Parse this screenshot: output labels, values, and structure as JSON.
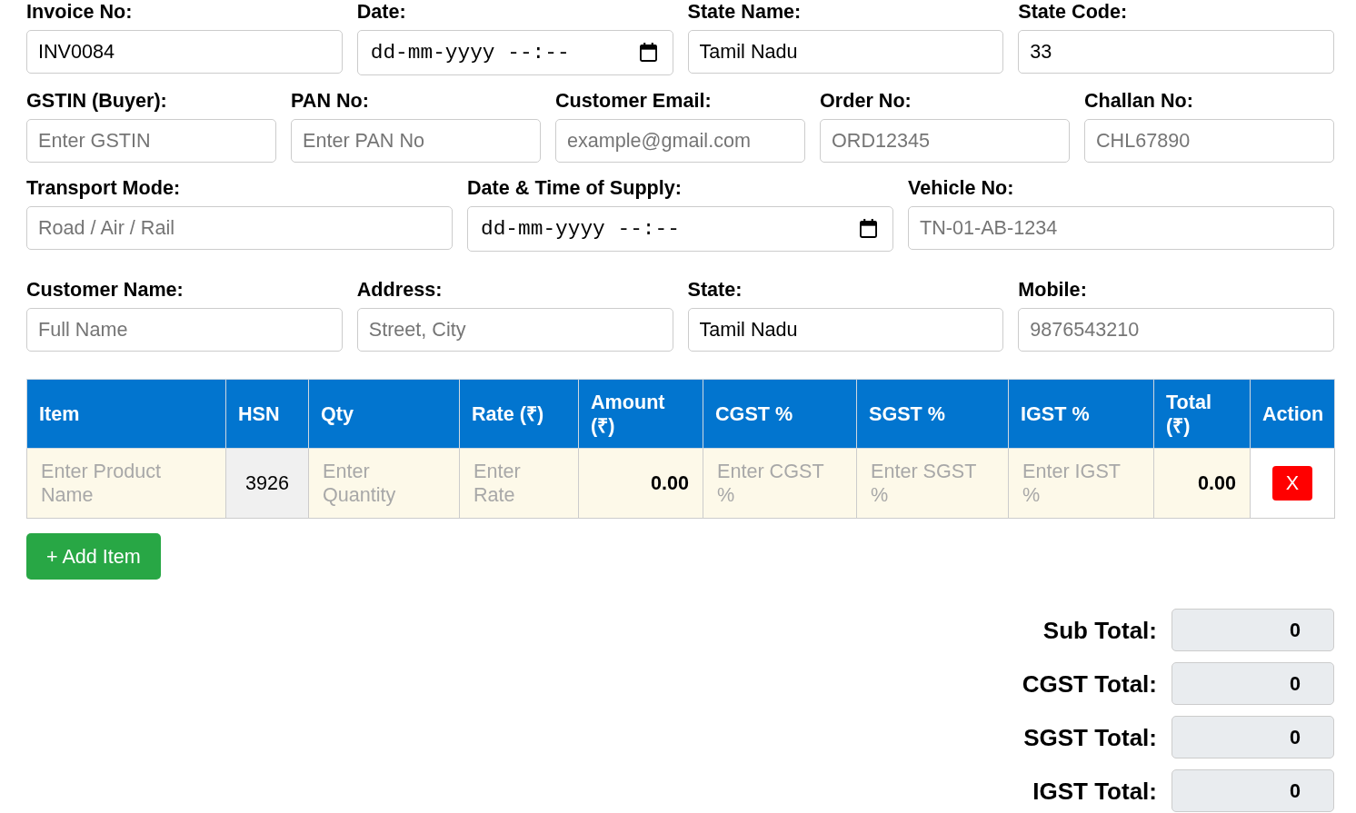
{
  "invoice_rows": [
    {
      "fields": [
        {
          "label": "Invoice No:",
          "kind": "text",
          "value": "INV0084"
        },
        {
          "label": "Date:",
          "kind": "datetime",
          "placeholder": "dd-mm-yyyy --:--"
        },
        {
          "label": "State Name:",
          "kind": "text",
          "value": "Tamil Nadu"
        },
        {
          "label": "State Code:",
          "kind": "text",
          "value": "33"
        }
      ]
    },
    {
      "fields": [
        {
          "label": "GSTIN (Buyer):",
          "kind": "text",
          "placeholder": "Enter GSTIN"
        },
        {
          "label": "PAN No:",
          "kind": "text",
          "placeholder": "Enter PAN No"
        },
        {
          "label": "Customer Email:",
          "kind": "text",
          "placeholder": "example@gmail.com"
        },
        {
          "label": "Order No:",
          "kind": "text",
          "placeholder": "ORD12345"
        },
        {
          "label": "Challan No:",
          "kind": "text",
          "placeholder": "CHL67890"
        }
      ]
    },
    {
      "fields": [
        {
          "label": "Transport Mode:",
          "kind": "text",
          "placeholder": "Road / Air / Rail"
        },
        {
          "label": "Date & Time of Supply:",
          "kind": "datetime",
          "placeholder": "dd-mm-yyyy --:--"
        },
        {
          "label": "Vehicle No:",
          "kind": "text",
          "placeholder": "TN-01-AB-1234"
        }
      ]
    }
  ],
  "customer_rows": [
    {
      "fields": [
        {
          "label": "Customer Name:",
          "kind": "text",
          "placeholder": "Full Name"
        },
        {
          "label": "Address:",
          "kind": "text",
          "placeholder": "Street, City"
        },
        {
          "label": "State:",
          "kind": "text",
          "value": "Tamil Nadu"
        },
        {
          "label": "Mobile:",
          "kind": "text",
          "placeholder": "9876543210"
        }
      ]
    }
  ],
  "items_table": {
    "columns": [
      "Item",
      "HSN",
      "Qty",
      "Rate (₹)",
      "Amount (₹)",
      "CGST %",
      "SGST %",
      "IGST %",
      "Total (₹)",
      "Action"
    ],
    "rows": [
      {
        "cells": [
          {
            "kind": "input",
            "placeholder": "Enter Product Name"
          },
          {
            "kind": "readonly",
            "value": "3926"
          },
          {
            "kind": "input",
            "placeholder": "Enter Quantity"
          },
          {
            "kind": "input",
            "placeholder": "Enter Rate"
          },
          {
            "kind": "amount",
            "text": "0.00"
          },
          {
            "kind": "input",
            "placeholder": "Enter CGST %"
          },
          {
            "kind": "input",
            "placeholder": "Enter SGST %"
          },
          {
            "kind": "input",
            "placeholder": "Enter IGST %"
          },
          {
            "kind": "amount",
            "text": "0.00"
          },
          {
            "kind": "action",
            "label": "X"
          }
        ]
      }
    ]
  },
  "add_button": {
    "label": "+ Add Item"
  },
  "totals": [
    {
      "label": "Sub Total:",
      "value": "0"
    },
    {
      "label": "CGST Total:",
      "value": "0"
    },
    {
      "label": "SGST Total:",
      "value": "0"
    },
    {
      "label": "IGST Total:",
      "value": "0"
    }
  ]
}
